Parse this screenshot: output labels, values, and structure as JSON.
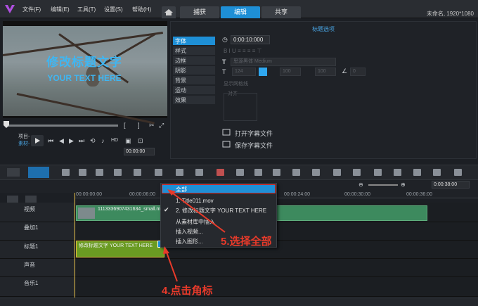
{
  "menubar": {
    "items": [
      "文件(F)",
      "编辑(E)",
      "工具(T)",
      "设置(S)",
      "帮助(H)"
    ],
    "project_info": "未命名, 1920*1080"
  },
  "tabs": [
    "捕获",
    "编辑",
    "共享"
  ],
  "preview": {
    "title_cn": "修改标题文字",
    "title_en": "YOUR TEXT HERE",
    "project_label": "项目-",
    "clip_label": "素材-",
    "timecode": "00:00:00",
    "zoom_label": "-"
  },
  "options": {
    "header": "标题选项",
    "categories": [
      "字体",
      "样式",
      "边框",
      "阴影",
      "背景",
      "运动",
      "效果"
    ],
    "duration": "0:00:10:000",
    "font_name": "思源黑体 Medium",
    "font_size": "124",
    "line_spacing": "100",
    "letter_spacing": "100",
    "rotation": "0",
    "grid_label": "显示网格线",
    "align_label": "对齐",
    "open_subtitle": "打开字幕文件",
    "save_subtitle": "保存字幕文件"
  },
  "timeline": {
    "zoom_time": "0:00:38:00",
    "ruler": [
      "00:00:00:00",
      "00:00:06:00",
      "00:00:24:00",
      "00:00:30:00",
      "00:00:36:00"
    ],
    "tracks": [
      {
        "name": "视频"
      },
      {
        "name": "叠加1"
      },
      {
        "name": "标题1"
      },
      {
        "name": "声音"
      },
      {
        "name": "音乐1"
      }
    ],
    "video_clip": "1113336907431634_small.mp4",
    "title_clip": "修改标题文字 YOUR TEXT HERE"
  },
  "context_menu": {
    "items": [
      "全部",
      "1. Title011.mov",
      "2. 修改标题文字  YOUR TEXT HERE",
      "从素材库中插入",
      "插入视频...",
      "插入图形..."
    ]
  },
  "annotations": {
    "step4": "4.点击角标",
    "step5": "5.选择全部"
  },
  "colors": {
    "accent": "#1e8fd6",
    "title_text": "#3fb6f2",
    "annotation": "#e83a2a"
  }
}
